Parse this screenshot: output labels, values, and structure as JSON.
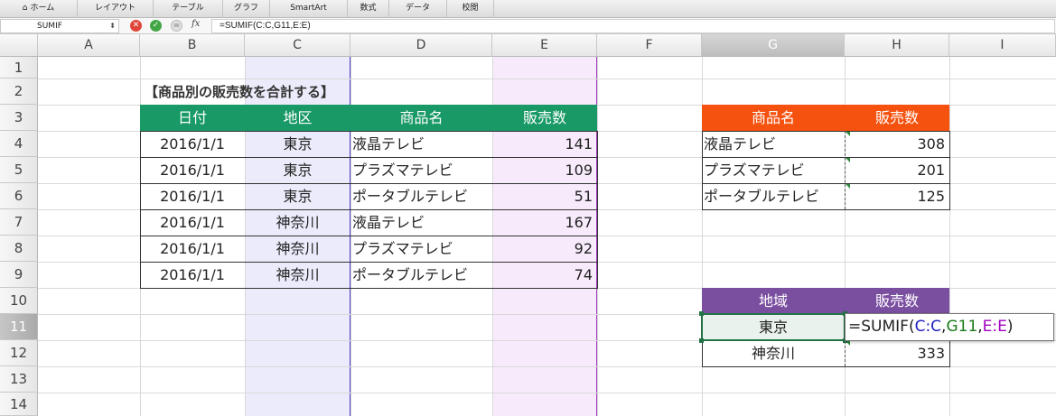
{
  "ribbon": {
    "tabs": [
      "ホーム",
      "レイアウト",
      "テーブル",
      "グラフ",
      "SmartArt",
      "数式",
      "データ",
      "校閲"
    ]
  },
  "formula_bar": {
    "name_box": "SUMIF",
    "fx_label": "fx",
    "formula": "=SUMIF(C:C,G11,E:E)"
  },
  "columns": [
    "A",
    "B",
    "C",
    "D",
    "E",
    "F",
    "G",
    "H",
    "I"
  ],
  "rows": [
    "1",
    "2",
    "3",
    "4",
    "5",
    "6",
    "7",
    "8",
    "9",
    "10",
    "11",
    "12",
    "13",
    "14"
  ],
  "title": "【商品別の販売数を合計する】",
  "main_table": {
    "headers": [
      "日付",
      "地区",
      "商品名",
      "販売数"
    ],
    "rows": [
      [
        "2016/1/1",
        "東京",
        "液晶テレビ",
        "141"
      ],
      [
        "2016/1/1",
        "東京",
        "プラズマテレビ",
        "109"
      ],
      [
        "2016/1/1",
        "東京",
        "ポータブルテレビ",
        "51"
      ],
      [
        "2016/1/1",
        "神奈川",
        "液晶テレビ",
        "167"
      ],
      [
        "2016/1/1",
        "神奈川",
        "プラズマテレビ",
        "92"
      ],
      [
        "2016/1/1",
        "神奈川",
        "ポータブルテレビ",
        "74"
      ]
    ]
  },
  "product_table": {
    "headers": [
      "商品名",
      "販売数"
    ],
    "rows": [
      [
        "液晶テレビ",
        "308"
      ],
      [
        "プラズマテレビ",
        "201"
      ],
      [
        "ポータブルテレビ",
        "125"
      ]
    ]
  },
  "region_table": {
    "headers": [
      "地域",
      "販売数"
    ],
    "rows": [
      [
        "東京",
        ""
      ],
      [
        "神奈川",
        "333"
      ]
    ]
  },
  "editing": {
    "prefix": "=SUMIF(",
    "ref1": "C:C",
    "sep1": ",",
    "ref2": "G11",
    "sep2": ",",
    "ref3": "E:E",
    "suffix": ")"
  },
  "colors": {
    "green_header": "#189966",
    "orange_header": "#f5520f",
    "purple_header": "#7b4fa0",
    "col_c_highlight": "#ebebfb",
    "col_e_highlight": "#f7ebfb",
    "ref_c_color": "#2020c0",
    "ref_g_color": "#1a7a1a",
    "ref_e_color": "#a000c0"
  }
}
